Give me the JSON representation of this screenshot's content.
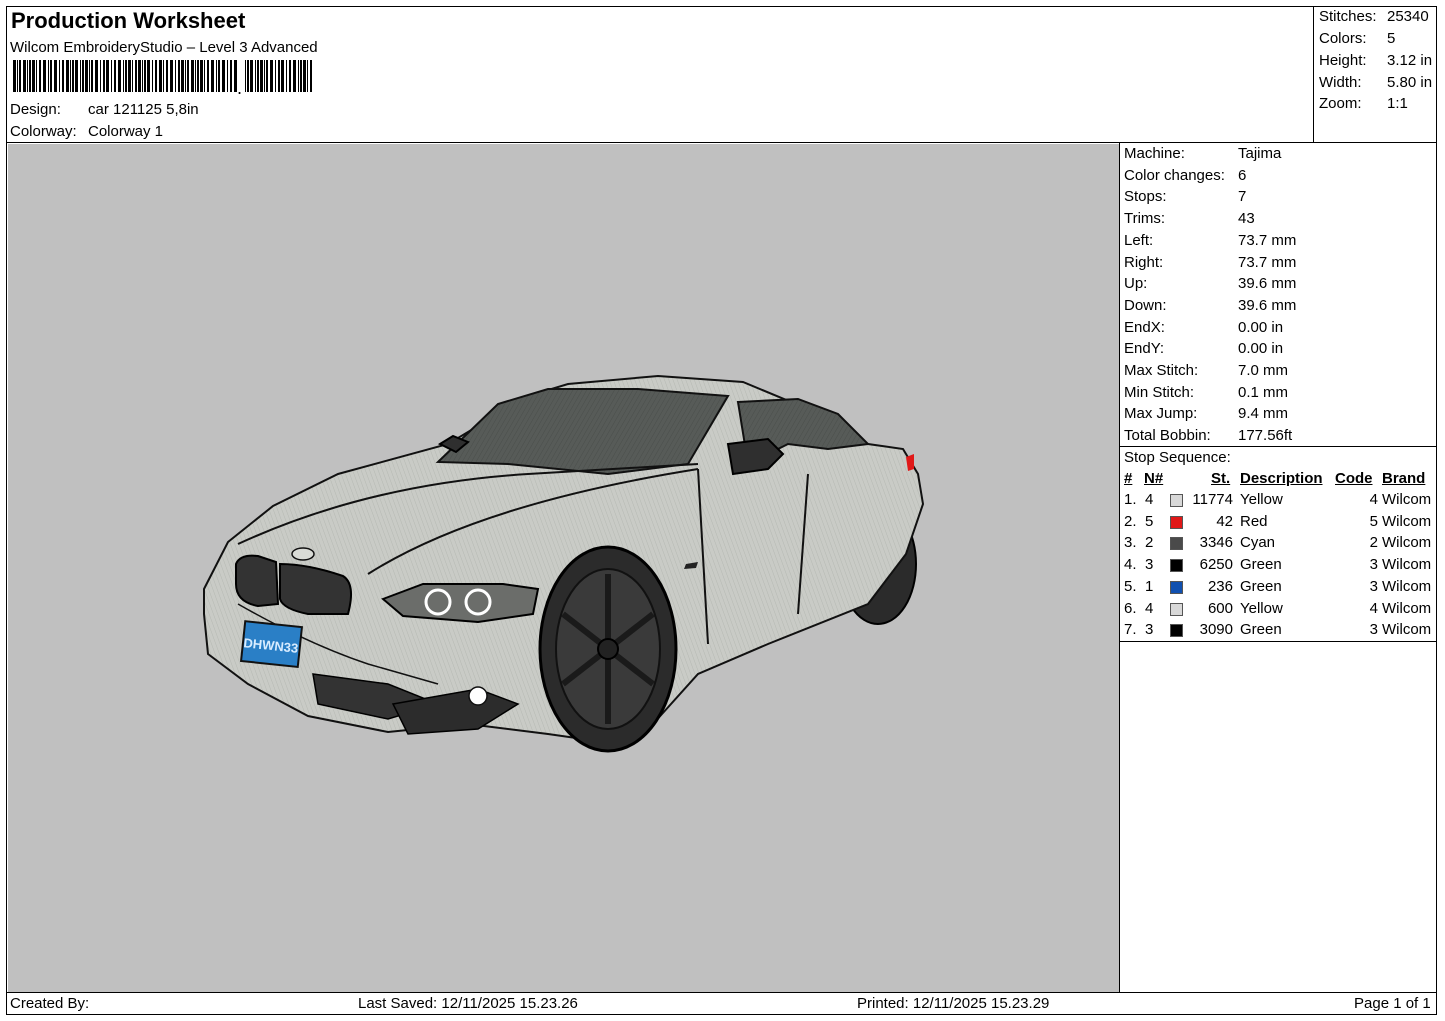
{
  "header": {
    "title": "Production Worksheet",
    "subtitle": "Wilcom EmbroideryStudio – Level 3 Advanced",
    "design_label": "Design:",
    "design_value": "car 121125 5,8in",
    "colorway_label": "Colorway:",
    "colorway_value": "Colorway 1"
  },
  "stats": [
    {
      "label": "Stitches:",
      "value": "25340"
    },
    {
      "label": "Colors:",
      "value": "5"
    },
    {
      "label": "Height:",
      "value": "3.12 in"
    },
    {
      "label": "Width:",
      "value": "5.80 in"
    },
    {
      "label": "Zoom:",
      "value": "1:1"
    }
  ],
  "machine_info": [
    {
      "label": "Machine:",
      "value": "Tajima"
    },
    {
      "label": "Color changes:",
      "value": "6"
    },
    {
      "label": "Stops:",
      "value": "7"
    },
    {
      "label": "Trims:",
      "value": "43"
    },
    {
      "label": "Left:",
      "value": "73.7 mm"
    },
    {
      "label": "Right:",
      "value": "73.7 mm"
    },
    {
      "label": "Up:",
      "value": "39.6 mm"
    },
    {
      "label": "Down:",
      "value": "39.6 mm"
    },
    {
      "label": "EndX:",
      "value": "0.00 in"
    },
    {
      "label": "EndY:",
      "value": "0.00 in"
    },
    {
      "label": "Max Stitch:",
      "value": "7.0 mm"
    },
    {
      "label": "Min Stitch:",
      "value": "0.1 mm"
    },
    {
      "label": "Max Jump:",
      "value": "9.4 mm"
    },
    {
      "label": "Total Bobbin:",
      "value": "177.56ft"
    }
  ],
  "stop_sequence": {
    "title": "Stop Sequence:",
    "columns": {
      "num": "#",
      "needle": "N#",
      "stitches": "St.",
      "description": "Description",
      "code": "Code",
      "brand": "Brand"
    },
    "rows": [
      {
        "num": "1.",
        "needle": "4",
        "color": "#d8d8d8",
        "stitches": "11774",
        "description": "Yellow",
        "code": "4",
        "brand": "Wilcom"
      },
      {
        "num": "2.",
        "needle": "5",
        "color": "#e01818",
        "stitches": "42",
        "description": "Red",
        "code": "5",
        "brand": "Wilcom"
      },
      {
        "num": "3.",
        "needle": "2",
        "color": "#4a4a4a",
        "stitches": "3346",
        "description": "Cyan",
        "code": "2",
        "brand": "Wilcom"
      },
      {
        "num": "4.",
        "needle": "3",
        "color": "#000000",
        "stitches": "6250",
        "description": "Green",
        "code": "3",
        "brand": "Wilcom"
      },
      {
        "num": "5.",
        "needle": "1",
        "color": "#1050b0",
        "stitches": "236",
        "description": "Green",
        "code": "3",
        "brand": "Wilcom"
      },
      {
        "num": "6.",
        "needle": "4",
        "color": "#d8d8d8",
        "stitches": "600",
        "description": "Yellow",
        "code": "4",
        "brand": "Wilcom"
      },
      {
        "num": "7.",
        "needle": "3",
        "color": "#000000",
        "stitches": "3090",
        "description": "Green",
        "code": "3",
        "brand": "Wilcom"
      }
    ]
  },
  "footer": {
    "created_by": "Created By:",
    "last_saved": "Last Saved: 12/11/2025 15.23.26",
    "printed": "Printed: 12/11/2025 15.23.29",
    "page": "Page 1 of 1"
  },
  "colors": {
    "canvas_bg": "#c0c0c0",
    "car_body": "#c9cbc6",
    "window": "#5a5e5b",
    "wheel": "#2b2b2b",
    "plate": "#2a7fc6"
  },
  "design_image": {
    "icon": "car-embroidery-preview",
    "plate_text": "DHWN33"
  }
}
